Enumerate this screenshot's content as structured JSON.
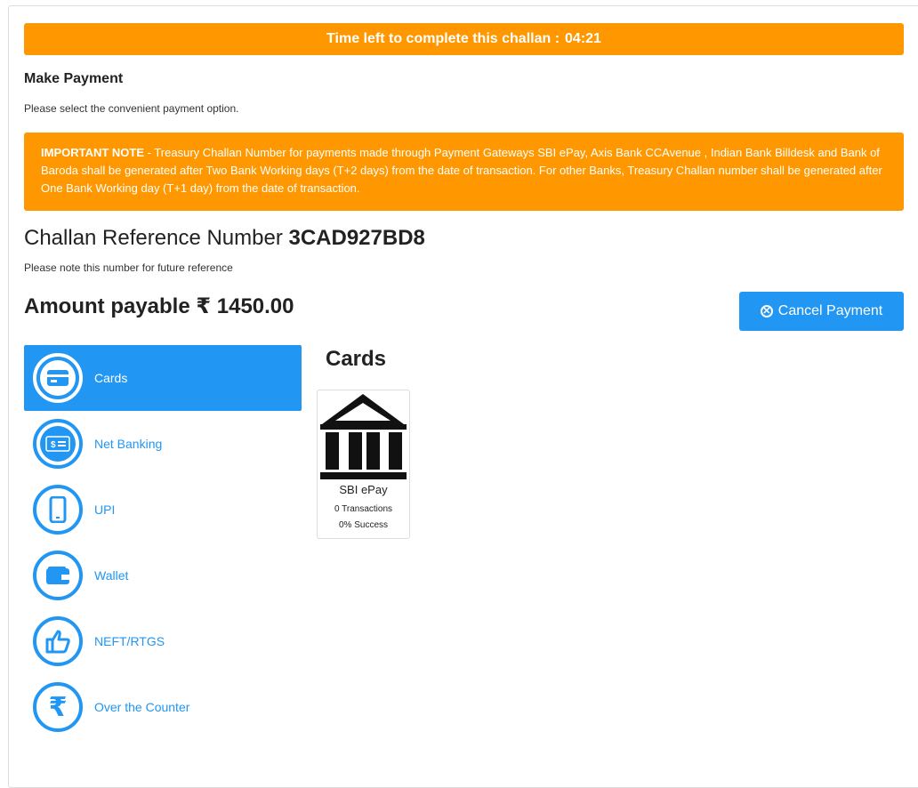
{
  "timer": {
    "label": "Time left to complete this challan :",
    "time": "04:21"
  },
  "payment": {
    "heading": "Make Payment",
    "subtext": "Please select the convenient payment option."
  },
  "note": {
    "label": "IMPORTANT NOTE",
    "text": " - Treasury Challan Number for payments made through Payment Gateways SBI ePay, Axis Bank CCAvenue , Indian Bank Billdesk and Bank of Baroda shall be generated after Two Bank Working days (T+2 days) from the date of transaction. For other Banks, Treasury Challan number shall be generated after One Bank Working day (T+1 day) from the date of transaction."
  },
  "challan": {
    "ref_label": "Challan Reference Number",
    "ref_number": "3CAD927BD8",
    "ref_note": "Please note this number for future reference",
    "amount_label": "Amount payable",
    "currency": "₹",
    "amount": "1450.00"
  },
  "cancel_button": {
    "label": "Cancel Payment",
    "icon": "close-circle-icon"
  },
  "menu": {
    "items": [
      {
        "label": "Cards",
        "icon": "card-icon",
        "active": true
      },
      {
        "label": "Net Banking",
        "icon": "cash-icon",
        "active": false
      },
      {
        "label": "UPI",
        "icon": "mobile-icon",
        "active": false
      },
      {
        "label": "Wallet",
        "icon": "wallet-icon",
        "active": false
      },
      {
        "label": "NEFT/RTGS",
        "icon": "thumbs-up-icon",
        "active": false
      },
      {
        "label": "Over the Counter",
        "icon": "rupee-icon",
        "active": false
      }
    ]
  },
  "cards_section": {
    "title": "Cards",
    "gateways": [
      {
        "name": "SBI ePay",
        "transactions": "0 Transactions",
        "success": "0% Success",
        "icon": "bank-icon"
      }
    ]
  },
  "colors": {
    "accent": "#2196f3",
    "warning": "#ff9800"
  }
}
